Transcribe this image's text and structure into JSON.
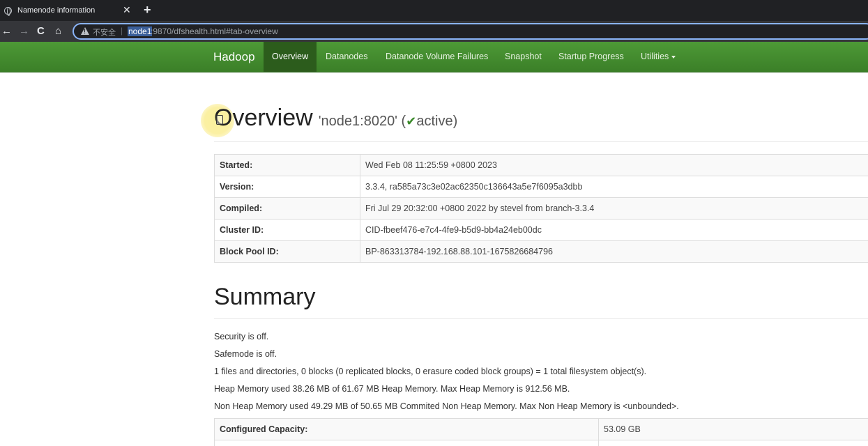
{
  "browser": {
    "tab_title": "Namenode information",
    "tab_close": "✕",
    "new_tab": "+",
    "back": "←",
    "forward": "→",
    "reload": "C",
    "home": "⌂",
    "insecure_label": "不安全",
    "separator": "|",
    "url_host": "node1",
    "url_rest": ":9870/dfshealth.html#tab-overview"
  },
  "navbar": {
    "brand": "Hadoop",
    "items": [
      {
        "label": "Overview"
      },
      {
        "label": "Datanodes"
      },
      {
        "label": "Datanode Volume Failures"
      },
      {
        "label": "Snapshot"
      },
      {
        "label": "Startup Progress"
      },
      {
        "label": "Utilities"
      }
    ]
  },
  "overview": {
    "title": "Overview",
    "node": "'node1:8020' (",
    "check": "✔",
    "status": "active)",
    "rows": [
      {
        "key": "Started:",
        "value": "Wed Feb 08 11:25:59 +0800 2023"
      },
      {
        "key": "Version:",
        "value": "3.3.4, ra585a73c3e02ac62350c136643a5e7f6095a3dbb"
      },
      {
        "key": "Compiled:",
        "value": "Fri Jul 29 20:32:00 +0800 2022 by stevel from branch-3.3.4"
      },
      {
        "key": "Cluster ID:",
        "value": "CID-fbeef476-e7c4-4fe9-b5d9-bb4a24eb00dc"
      },
      {
        "key": "Block Pool ID:",
        "value": "BP-863313784-192.168.88.101-1675826684796"
      }
    ]
  },
  "summary": {
    "title": "Summary",
    "lines": [
      "Security is off.",
      "Safemode is off.",
      "1 files and directories, 0 blocks (0 replicated blocks, 0 erasure coded block groups) = 1 total filesystem object(s).",
      "Heap Memory used 38.26 MB of 61.67 MB Heap Memory. Max Heap Memory is 912.56 MB.",
      "Non Heap Memory used 49.29 MB of 50.65 MB Commited Non Heap Memory. Max Non Heap Memory is <unbounded>."
    ],
    "capacity_rows": [
      {
        "key": "Configured Capacity:",
        "value": "53.09 GB"
      }
    ]
  },
  "colors": {
    "navbar": "#3b7f28",
    "navbar_active": "#2c5c1c",
    "check": "#3a8a2a"
  }
}
